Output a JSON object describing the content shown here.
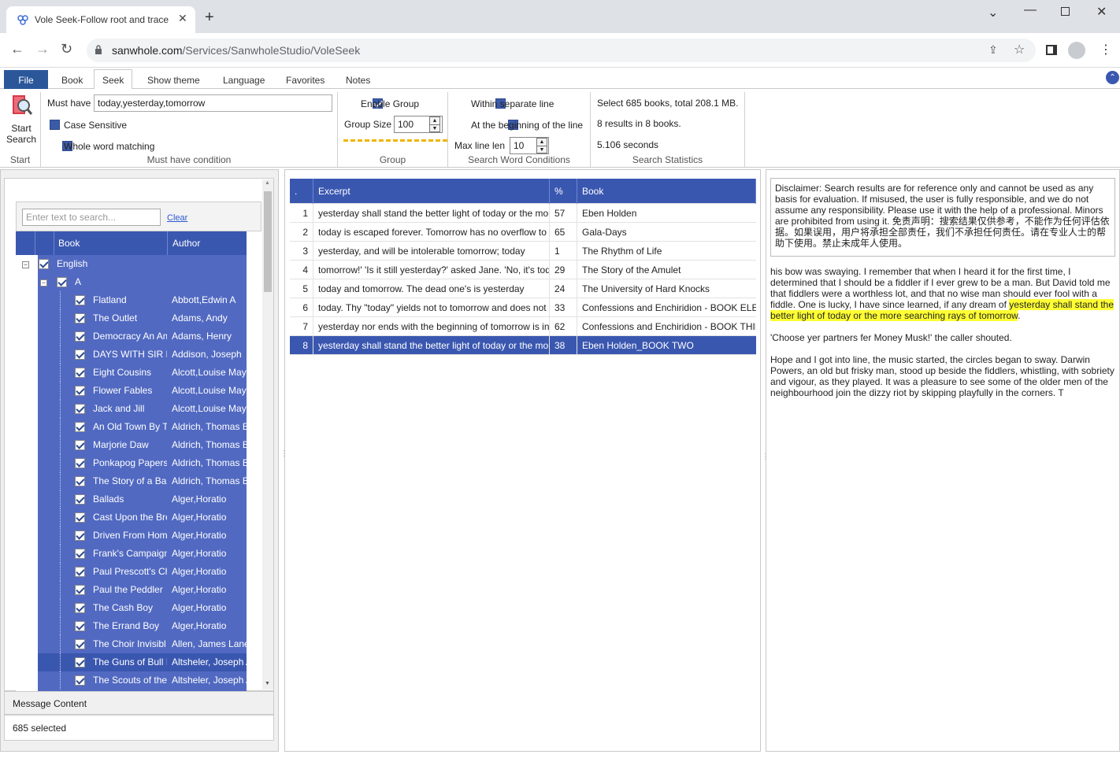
{
  "browser": {
    "tab_title": "Vole Seek-Follow root and trace",
    "url_host": "sanwhole.com",
    "url_path": "/Services/SanwholeStudio/VoleSeek"
  },
  "ribbon": {
    "tabs": [
      "File",
      "Book",
      "Seek",
      "Show theme",
      "Language",
      "Favorites",
      "Notes"
    ],
    "start_label_1": "Start",
    "start_label_2": "Search",
    "group_start": "Start",
    "must_have_label": "Must have",
    "must_have_value": "today,yesterday,tomorrow",
    "case_sensitive": "Case Sensitive",
    "whole_word": "Whole word matching",
    "group_must_have": "Must have condition",
    "enable_group": "Enable Group",
    "group_size_label": "Group Size",
    "group_size_value": "100",
    "group_group": "Group",
    "within_line": "Within separate line",
    "at_beginning": "At the beginning of the line",
    "max_line_len_label": "Max line len",
    "max_line_len_value": "10",
    "group_search_word": "Search Word Conditions",
    "stat_books": "Select 685 books, total 208.1 MB.",
    "stat_results": "8 results in 8 books.",
    "stat_time": "5.106 seconds",
    "group_stats": "Search Statistics"
  },
  "left": {
    "search_placeholder": "Enter text to search...",
    "clear_label": "Clear",
    "col_book": "Book",
    "col_author": "Author",
    "root": "English",
    "folder": "A",
    "books": [
      {
        "book": "Flatland",
        "author": "Abbott,Edwin A"
      },
      {
        "book": "The Outlet",
        "author": "Adams, Andy"
      },
      {
        "book": "Democracy An Am",
        "author": "Adams, Henry"
      },
      {
        "book": "DAYS WITH SIR R",
        "author": "Addison, Joseph"
      },
      {
        "book": "Eight Cousins",
        "author": "Alcott,Louise May"
      },
      {
        "book": "Flower Fables",
        "author": "Alcott,Louise May"
      },
      {
        "book": "Jack and Jill",
        "author": "Alcott,Louise May"
      },
      {
        "book": "An Old Town By T",
        "author": "Aldrich, Thomas B"
      },
      {
        "book": "Marjorie Daw",
        "author": "Aldrich, Thomas B"
      },
      {
        "book": "Ponkapog Papers",
        "author": "Aldrich, Thomas B"
      },
      {
        "book": "The Story of a Ba",
        "author": "Aldrich, Thomas B"
      },
      {
        "book": "Ballads",
        "author": "Alger,Horatio"
      },
      {
        "book": "Cast Upon the Bre",
        "author": "Alger,Horatio"
      },
      {
        "book": "Driven From Hom",
        "author": "Alger,Horatio"
      },
      {
        "book": "Frank's Campaign",
        "author": "Alger,Horatio"
      },
      {
        "book": "Paul Prescott's Ch",
        "author": "Alger,Horatio"
      },
      {
        "book": "Paul the Peddler",
        "author": "Alger,Horatio"
      },
      {
        "book": "The Cash Boy",
        "author": "Alger,Horatio"
      },
      {
        "book": "The Errand Boy",
        "author": "Alger,Horatio"
      },
      {
        "book": "The Choir Invisibl",
        "author": "Allen, James Lane"
      },
      {
        "book": "The Guns of Bull I",
        "author": "Altsheler, Joseph A"
      },
      {
        "book": "The Scouts of the",
        "author": "Altsheler, Joseph A"
      }
    ],
    "message_header": "Message Content",
    "message_text": "685 selected"
  },
  "results": {
    "headers": [
      ".",
      "Excerpt",
      "%",
      "Book"
    ],
    "rows": [
      {
        "n": "1",
        "excerpt": "yesterday shall stand the better light of today or the more",
        "pct": "57",
        "book": "Eben Holden"
      },
      {
        "n": "2",
        "excerpt": "today is escaped forever. Tomorrow has no overflow to",
        "pct": "65",
        "book": "Gala-Days"
      },
      {
        "n": "3",
        "excerpt": "yesterday, and will be intolerable tomorrow; today",
        "pct": "1",
        "book": "The Rhythm of Life"
      },
      {
        "n": "4",
        "excerpt": "tomorrow!' 'Is it still yesterday?' asked Jane. 'No, it's today",
        "pct": "29",
        "book": "The Story of the Amulet"
      },
      {
        "n": "5",
        "excerpt": "today and tomorrow. The dead one's is yesterday",
        "pct": "24",
        "book": "The University of Hard Knocks"
      },
      {
        "n": "6",
        "excerpt": "today. Thy \"today\" yields not to tomorrow and does not",
        "pct": "33",
        "book": "Confessions and Enchiridion - BOOK ELEVEN"
      },
      {
        "n": "7",
        "excerpt": "yesterday nor ends with the beginning of tomorrow is in",
        "pct": "62",
        "book": "Confessions and Enchiridion - BOOK THIRTEEN"
      },
      {
        "n": "8",
        "excerpt": "yesterday shall stand the better light of today or the more",
        "pct": "38",
        "book": "Eben Holden_BOOK TWO"
      }
    ]
  },
  "preview": {
    "disclaimer": "Disclaimer: Search results are for reference only and cannot be used as any basis for evaluation. If misused, the user is fully responsible, and we do not assume any responsibility. Please use it with the help of a professional. Minors are prohibited from using it. 免责声明：搜索结果仅供参考，不能作为任何评估依据。如果误用，用户将承担全部责任，我们不承担任何责任。请在专业人士的帮助下使用。禁止未成年人使用。",
    "para1_before": "his bow was swaying. I remember that when I heard it for the first time, I determined that I should be a fiddler if I ever grew to be a man. But David told me that fiddlers were a worthless lot, and that no wise man should ever fool with a fiddle. One is lucky, I have since learned, if any dream of ",
    "para1_highlight": "yesterday shall stand the better light of today or the more searching rays of tomorrow",
    "para1_after": ".",
    "para2": "'Choose yer partners fer Money Musk!' the caller shouted.",
    "para3": "Hope and I got into line, the music started, the circles began to sway. Darwin Powers, an old but frisky man, stood up beside the fiddlers, whistling, with sobriety and vigour, as they played. It was a pleasure to see some of the older men of the neighbourhood join the dizzy riot by skipping playfully in the corners. T"
  }
}
